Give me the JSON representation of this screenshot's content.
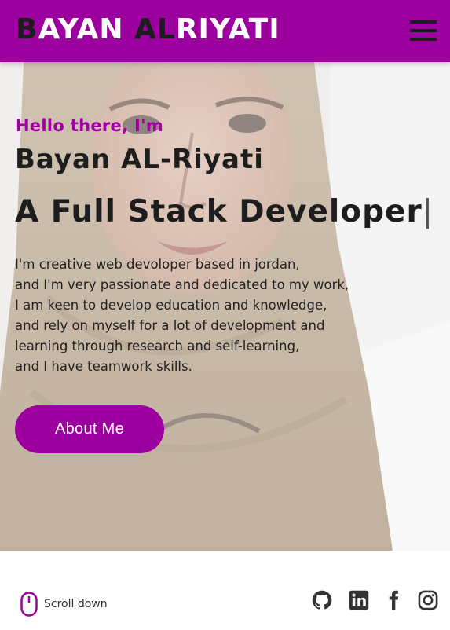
{
  "header": {
    "logo_first_initial": "B",
    "logo_first_rest": "AYAN ",
    "logo_second_initial": "AL",
    "logo_second_rest": "RIYATI",
    "background": "#9c009e"
  },
  "hero": {
    "greeting": "Hello there, I'm",
    "name": "Bayan AL-Riyati",
    "role": "A Full Stack Developer",
    "cursor": "|",
    "intro_lines": [
      "I'm creative web devoloper based in jordan,",
      "and I'm very passionate and dedicated to my work,",
      "I am keen to develop education and knowledge,",
      "and rely on myself for a lot of development and",
      "learning through research and self-learning,",
      "and I have teamwork skills."
    ],
    "cta_label": "About Me"
  },
  "footer": {
    "scroll_label": "Scroll down",
    "social_icons": [
      "github-icon",
      "linkedin-icon",
      "facebook-icon",
      "instagram-icon"
    ]
  },
  "colors": {
    "accent": "#9c009e",
    "dark": "#1d1d1d"
  }
}
